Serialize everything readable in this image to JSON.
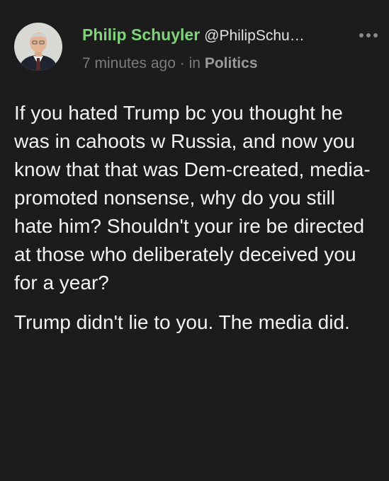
{
  "post": {
    "author": {
      "display_name": "Philip Schuyler",
      "handle": "@PhilipSchu…"
    },
    "time_ago": "7 minutes ago",
    "separator": "·",
    "category_prefix": "in",
    "category": "Politics",
    "paragraphs": [
      "If you hated Trump bc you thought he was in cahoots w Russia, and now you know that that was Dem-created, media-promoted nonsense, why do you still hate him? Shouldn't your ire be directed at those who deliberately deceived you for a year?",
      "Trump didn't lie to you. The media did."
    ]
  },
  "icons": {
    "avatar": "avatar-photo",
    "more": "more-options-icon"
  },
  "colors": {
    "background": "#1c1c1c",
    "name": "#7fd37a",
    "handle": "#e2e2e2",
    "meta": "#7c7c7c",
    "body_text": "#f2f2f2"
  }
}
